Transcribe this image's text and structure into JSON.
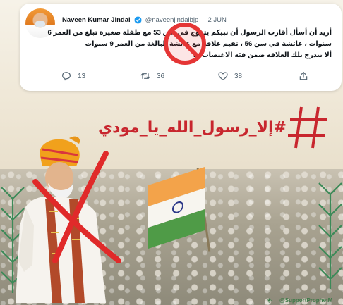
{
  "tweet": {
    "author_name": "Naveen Kumar Jindal",
    "handle": "@naveenjindalbjp",
    "separator": "·",
    "date": "2 JUN",
    "lines": [
      "أريد أن أسأل أقارب الرسول أن نبيكم يتزوج في سن 53 مع طفلة صغيرة تبلغ من العمر 6",
      "سنوات ، عائشة في سن 56 ، تقيم علاقة مع عائشة البالغة من العمر 9 سنوات",
      "ألا تندرج تلك العلاقة ضمن فئة الاغتصاب ..؟"
    ],
    "replies": "13",
    "retweets": "36",
    "likes": "38"
  },
  "banner": {
    "hashtag": "#إلا_رسول_الله_يا_مودي"
  },
  "footer": {
    "handle": "@SupportProphetM"
  },
  "colors": {
    "accent_red": "#c8262e",
    "twitter_blue": "#1d9bf0",
    "text_gray": "#536471"
  },
  "icons": [
    "verified-icon",
    "reply-icon",
    "retweet-icon",
    "like-icon",
    "share-icon",
    "prohibition-icon",
    "hashtag-icon"
  ]
}
